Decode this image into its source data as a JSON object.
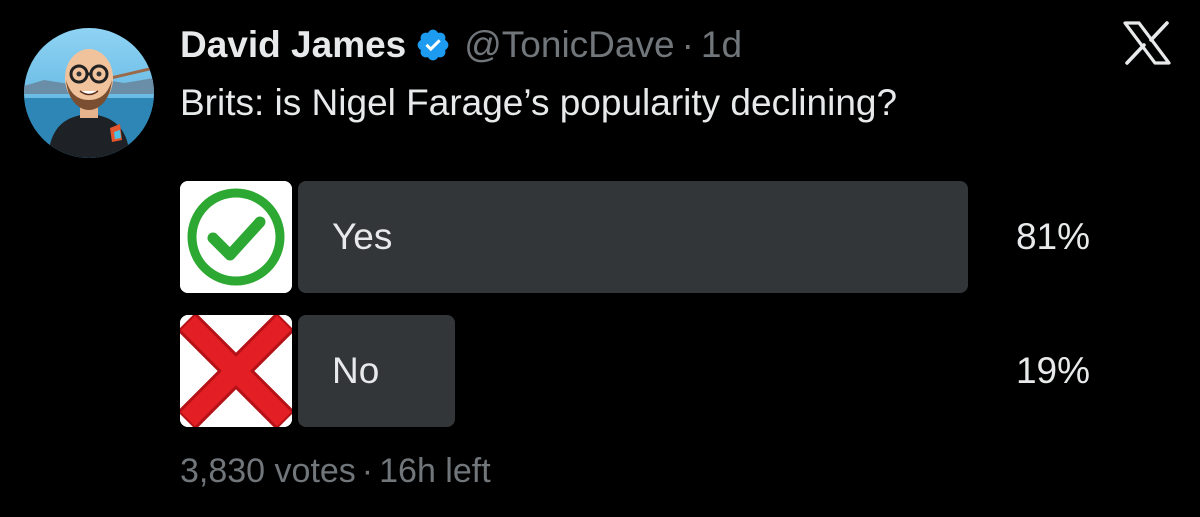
{
  "tweet": {
    "author_name": "David James",
    "handle": "@TonicDave",
    "separator": "·",
    "time_ago": "1d",
    "text": "Brits: is Nigel Farage’s popularity declining?",
    "verified_icon": "verified-badge-icon",
    "platform_icon": "x-logo-icon",
    "avatar": "avatar"
  },
  "poll": {
    "options": [
      {
        "label": "Yes",
        "percent_label": "81%",
        "percent": 81,
        "icon": "check-mark-icon"
      },
      {
        "label": "No",
        "percent_label": "19%",
        "percent": 19,
        "icon": "red-x-icon"
      }
    ],
    "votes": "3,830 votes",
    "separator": "·",
    "time_left": "16h left"
  },
  "colors": {
    "background": "#000000",
    "text_primary": "#e7e9ea",
    "text_secondary": "#71767b",
    "bar_fill": "#333639",
    "verified_blue": "#1d9bf0",
    "check_green": "#2da832",
    "cross_red": "#e31e24"
  }
}
